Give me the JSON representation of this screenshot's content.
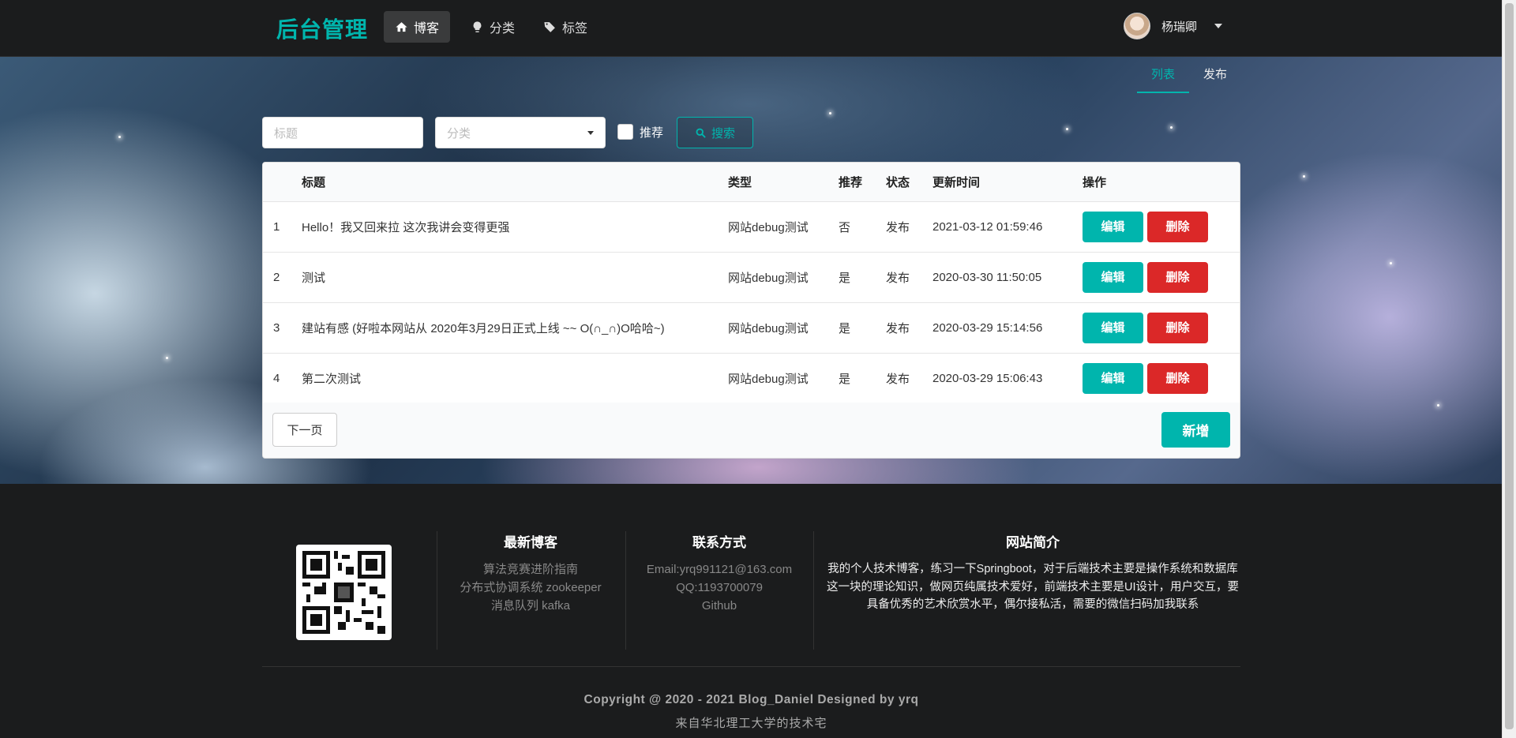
{
  "brand": "后台管理",
  "nav": [
    {
      "label": "博客",
      "icon": "home-icon",
      "active": true
    },
    {
      "label": "分类",
      "icon": "lightbulb-icon",
      "active": false
    },
    {
      "label": "标签",
      "icon": "tags-icon",
      "active": false
    }
  ],
  "user": {
    "name": "杨瑞卿"
  },
  "subnav": [
    {
      "label": "列表",
      "active": true
    },
    {
      "label": "发布",
      "active": false
    }
  ],
  "search": {
    "title_placeholder": "标题",
    "category_placeholder": "分类",
    "recommend_label": "推荐",
    "search_label": "搜索"
  },
  "table": {
    "headers": [
      "",
      "标题",
      "类型",
      "推荐",
      "状态",
      "更新时间",
      "操作"
    ],
    "rows": [
      {
        "idx": "1",
        "title": "Hello！我又回来拉 这次我讲会变得更强",
        "type": "网站debug测试",
        "recommend": "否",
        "status": "发布",
        "time": "2021-03-12 01:59:46"
      },
      {
        "idx": "2",
        "title": "测试",
        "type": "网站debug测试",
        "recommend": "是",
        "status": "发布",
        "time": "2020-03-30 11:50:05"
      },
      {
        "idx": "3",
        "title": "建站有感 (好啦本网站从 2020年3月29日正式上线 ~~ O(∩_∩)O哈哈~)",
        "type": "网站debug测试",
        "recommend": "是",
        "status": "发布",
        "time": "2020-03-29 15:14:56"
      },
      {
        "idx": "4",
        "title": "第二次测试",
        "type": "网站debug测试",
        "recommend": "是",
        "status": "发布",
        "time": "2020-03-29 15:06:43"
      }
    ],
    "edit_label": "编辑",
    "delete_label": "删除",
    "next_label": "下一页",
    "add_label": "新增"
  },
  "footer": {
    "latest": {
      "title": "最新博客",
      "items": [
        "算法竞赛进阶指南",
        "分布式协调系统 zookeeper",
        "消息队列 kafka"
      ]
    },
    "contact": {
      "title": "联系方式",
      "items": [
        "Email:yrq991121@163.com",
        "QQ:1193700079",
        "Github"
      ]
    },
    "about": {
      "title": "网站简介",
      "text": "我的个人技术博客，练习一下Springboot，对于后端技术主要是操作系统和数据库这一块的理论知识，做网页纯属技术爱好，前端技术主要是UI设计，用户交互，要具备优秀的艺术欣赏水平，偶尔接私活，需要的微信扫码加我联系"
    },
    "copyright": "Copyright @ 2020 - 2021 Blog_Daniel Designed by yrq",
    "subline": "来自华北理工大学的技术宅"
  },
  "colors": {
    "accent": "#00b5ad",
    "danger": "#db2828",
    "dark": "#1b1c1d"
  }
}
